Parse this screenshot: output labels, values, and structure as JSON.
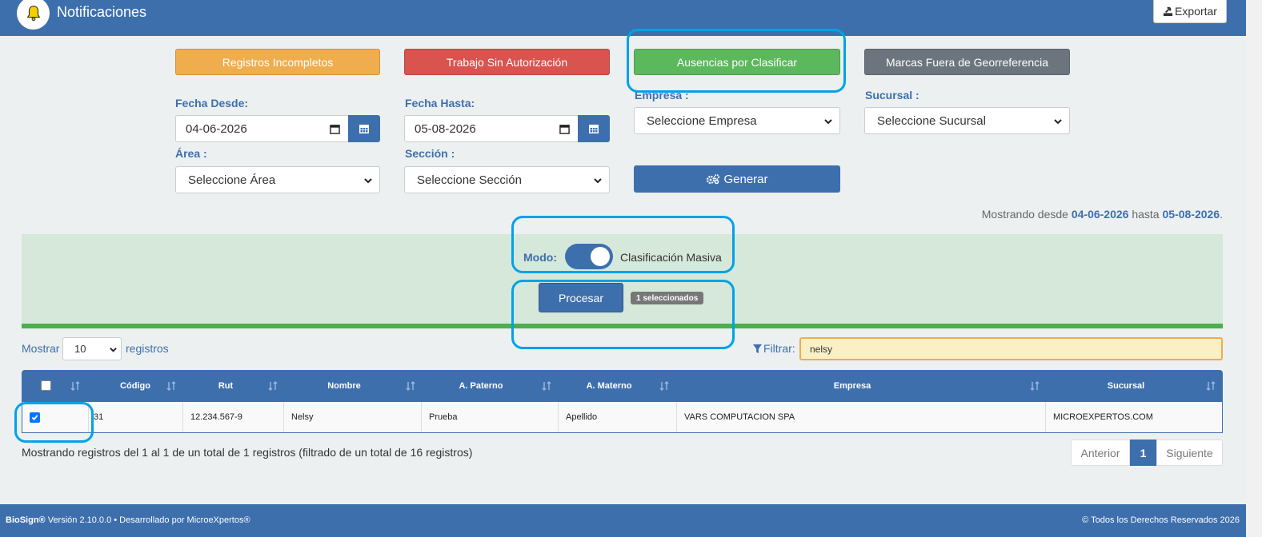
{
  "header": {
    "title": "Notificaciones",
    "export_label": "Exportar"
  },
  "notification_buttons": {
    "incompletos": "Registros Incompletos",
    "sin_autorizacion": "Trabajo Sin Autorización",
    "ausencias": "Ausencias por Clasificar",
    "georeferencia": "Marcas Fuera de Georreferencia"
  },
  "filters": {
    "fecha_desde_label": "Fecha Desde:",
    "fecha_desde_value": "04-06-2026",
    "fecha_hasta_label": "Fecha Hasta:",
    "fecha_hasta_value": "05-08-2026",
    "empresa_label": "Empresa :",
    "empresa_value": "Seleccione Empresa",
    "sucursal_label": "Sucursal :",
    "sucursal_value": "Seleccione Sucursal",
    "area_label": "Área :",
    "area_value": "Seleccione Área",
    "seccion_label": "Sección :",
    "seccion_value": "Seleccione Sección",
    "generar_label": "Generar"
  },
  "range": {
    "prefix": "Mostrando desde",
    "from": "04-06-2026",
    "middle": "hasta",
    "to": "05-08-2026",
    "suffix": "."
  },
  "mode": {
    "label": "Modo:",
    "toggle_on": true,
    "text": "Clasificación Masiva",
    "procesar_label": "Procesar",
    "selected_badge": "1 seleccionados"
  },
  "table_controls": {
    "mostrar": "Mostrar",
    "page_length": "10",
    "registros": "registros",
    "filtrar_label": "Filtrar:",
    "filter_value": "nelsy"
  },
  "table": {
    "columns": [
      "Código",
      "Rut",
      "Nombre",
      "A. Paterno",
      "A. Materno",
      "Empresa",
      "Sucursal"
    ],
    "rows": [
      {
        "checked": true,
        "codigo": "31",
        "rut": "12.234.567-9",
        "nombre": "Nelsy",
        "a_paterno": "Prueba",
        "a_materno": "Apellido",
        "empresa": "VARS COMPUTACION SPA",
        "sucursal": "MICROEXPERTOS.COM"
      }
    ]
  },
  "pagination": {
    "info": "Mostrando registros del 1 al 1 de un total de 1 registros (filtrado de un total de 16 registros)",
    "prev": "Anterior",
    "current": "1",
    "next": "Siguiente"
  },
  "footer": {
    "brand": "BioSign®",
    "version_text": " Versión 2.10.0.0 • Desarrollado por MicroeXpertos®",
    "copyright": "© Todos los Derechos Reservados 2026"
  },
  "colors": {
    "primary": "#3e6fad",
    "warning": "#f0ad4e",
    "danger": "#d9534f",
    "success": "#5cb85c",
    "grey": "#6c757d",
    "annotation": "#00a2e8"
  }
}
